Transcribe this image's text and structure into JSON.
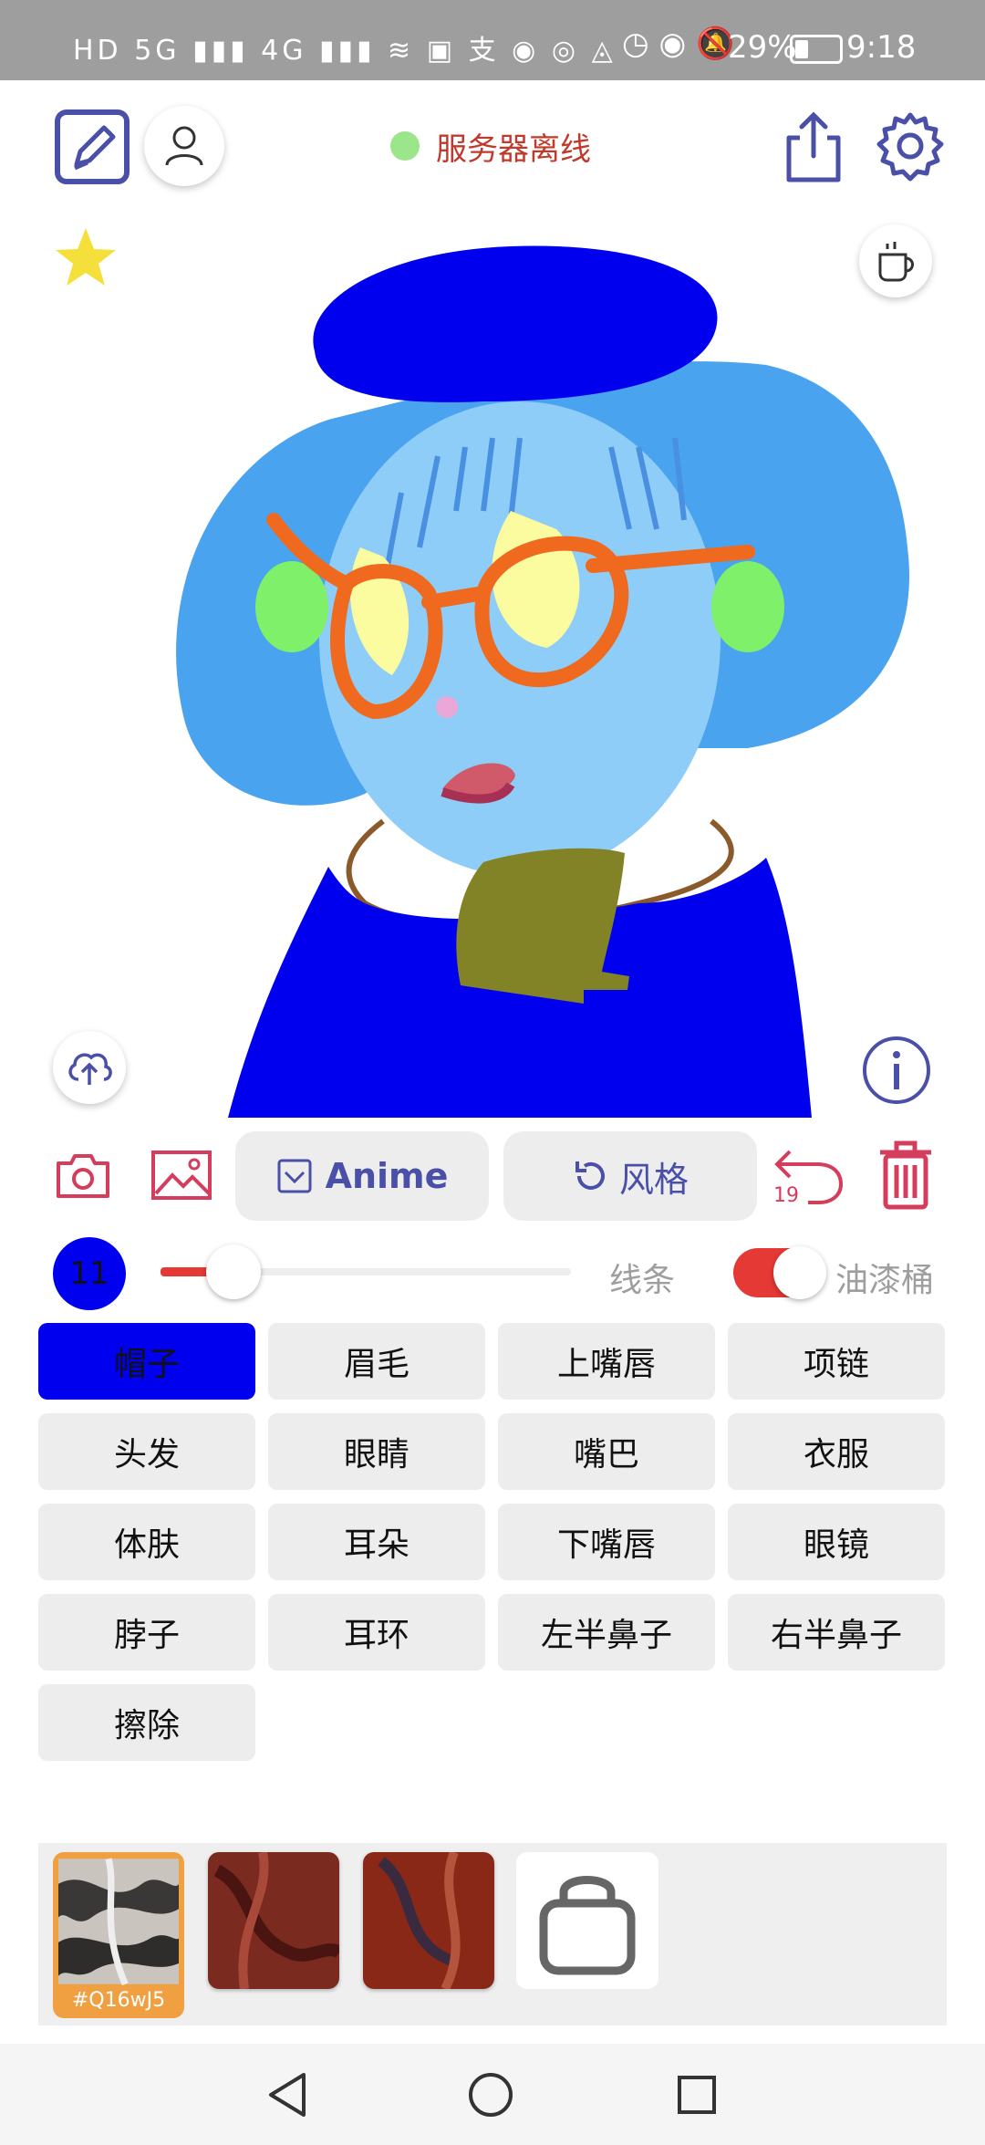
{
  "status_bar": {
    "left_icons": "HD 5G ▮▮▮ 4G ▮▮▮ ≋ ▣ 支 ◉ ◎ ◬",
    "battery_percent": "29%",
    "time": "9:18"
  },
  "top_bar": {
    "server_status": "服务器离线",
    "status_color": "#9be58b"
  },
  "toolbar": {
    "anime_button": "Anime",
    "style_button": "风格",
    "undo_count": "19"
  },
  "brush": {
    "size": "11",
    "slider_value": 0.12,
    "line_label": "线条",
    "bucket_label": "油漆桶",
    "bucket_enabled": true
  },
  "categories": [
    {
      "label": "帽子",
      "active": true
    },
    {
      "label": "眉毛"
    },
    {
      "label": "上嘴唇"
    },
    {
      "label": "项链"
    },
    {
      "label": "头发"
    },
    {
      "label": "眼睛"
    },
    {
      "label": "嘴巴"
    },
    {
      "label": "衣服"
    },
    {
      "label": "体肤"
    },
    {
      "label": "耳朵"
    },
    {
      "label": "下嘴唇"
    },
    {
      "label": "眼镜"
    },
    {
      "label": "脖子"
    },
    {
      "label": "耳环"
    },
    {
      "label": "左半鼻子"
    },
    {
      "label": "右半鼻子"
    },
    {
      "label": "擦除"
    }
  ],
  "styles": {
    "selected_code": "#Q16wJ5"
  },
  "colors": {
    "accent": "#4a4fa8",
    "active_category": "#0000ee",
    "danger": "#d43d5b"
  }
}
